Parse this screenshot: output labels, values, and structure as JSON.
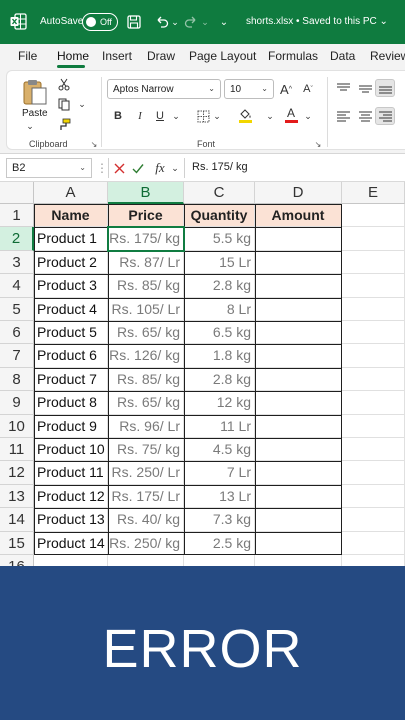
{
  "titlebar": {
    "autosave_label": "AutoSave",
    "autosave_state": "Off",
    "file_title": "shorts.xlsx • Saved to this PC ⌄"
  },
  "menu": {
    "tabs": [
      "File",
      "Home",
      "Insert",
      "Draw",
      "Page Layout",
      "Formulas",
      "Data",
      "Review"
    ]
  },
  "ribbon": {
    "paste_label": "Paste",
    "clipboard_label": "Clipboard",
    "font_label": "Font",
    "font_name": "Aptos Narrow",
    "font_size": "10",
    "bold": "B",
    "italic": "I",
    "underline": "U",
    "grow_font": "A",
    "shrink_font": "A",
    "font_color": "A",
    "fill_color_hex": "#f2d600",
    "font_color_hex": "#e31b1b"
  },
  "formula_bar": {
    "name_box": "B2",
    "fx": "fx",
    "value": "Rs. 175/ kg"
  },
  "grid": {
    "columns": [
      "A",
      "B",
      "C",
      "D",
      "E"
    ],
    "row_numbers": [
      "1",
      "2",
      "3",
      "4",
      "5",
      "6",
      "7",
      "8",
      "9",
      "10",
      "11",
      "12",
      "13",
      "14",
      "15",
      "16"
    ],
    "headers": [
      "Name",
      "Price",
      "Quantity",
      "Amount"
    ],
    "rows": [
      {
        "name": "Product 1",
        "price": "Rs. 175/ kg",
        "qty": "5.5 kg",
        "amount": ""
      },
      {
        "name": "Product 2",
        "price": "Rs. 87/ Lr",
        "qty": "15 Lr",
        "amount": ""
      },
      {
        "name": "Product 3",
        "price": "Rs. 85/ kg",
        "qty": "2.8 kg",
        "amount": ""
      },
      {
        "name": "Product 4",
        "price": "Rs. 105/ Lr",
        "qty": "8 Lr",
        "amount": ""
      },
      {
        "name": "Product 5",
        "price": "Rs. 65/ kg",
        "qty": "6.5 kg",
        "amount": ""
      },
      {
        "name": "Product 6",
        "price": "Rs. 126/ kg",
        "qty": "1.8 kg",
        "amount": ""
      },
      {
        "name": "Product 7",
        "price": "Rs. 85/ kg",
        "qty": "2.8 kg",
        "amount": ""
      },
      {
        "name": "Product 8",
        "price": "Rs. 65/ kg",
        "qty": "12 kg",
        "amount": ""
      },
      {
        "name": "Product 9",
        "price": "Rs. 96/ Lr",
        "qty": "11 Lr",
        "amount": ""
      },
      {
        "name": "Product 10",
        "price": "Rs. 75/ kg",
        "qty": "4.5 kg",
        "amount": ""
      },
      {
        "name": "Product 11",
        "price": "Rs. 250/ Lr",
        "qty": "7 Lr",
        "amount": ""
      },
      {
        "name": "Product 12",
        "price": "Rs. 175/ Lr",
        "qty": "13 Lr",
        "amount": ""
      },
      {
        "name": "Product 13",
        "price": "Rs. 40/ kg",
        "qty": "7.3 kg",
        "amount": ""
      },
      {
        "name": "Product 14",
        "price": "Rs. 250/ kg",
        "qty": "2.5 kg",
        "amount": ""
      }
    ],
    "selected_cell": "B2",
    "header_fill": "#fbe2d5",
    "selection_color": "#107c41"
  },
  "banner": {
    "text": "ERROR",
    "color": "#254a82"
  }
}
